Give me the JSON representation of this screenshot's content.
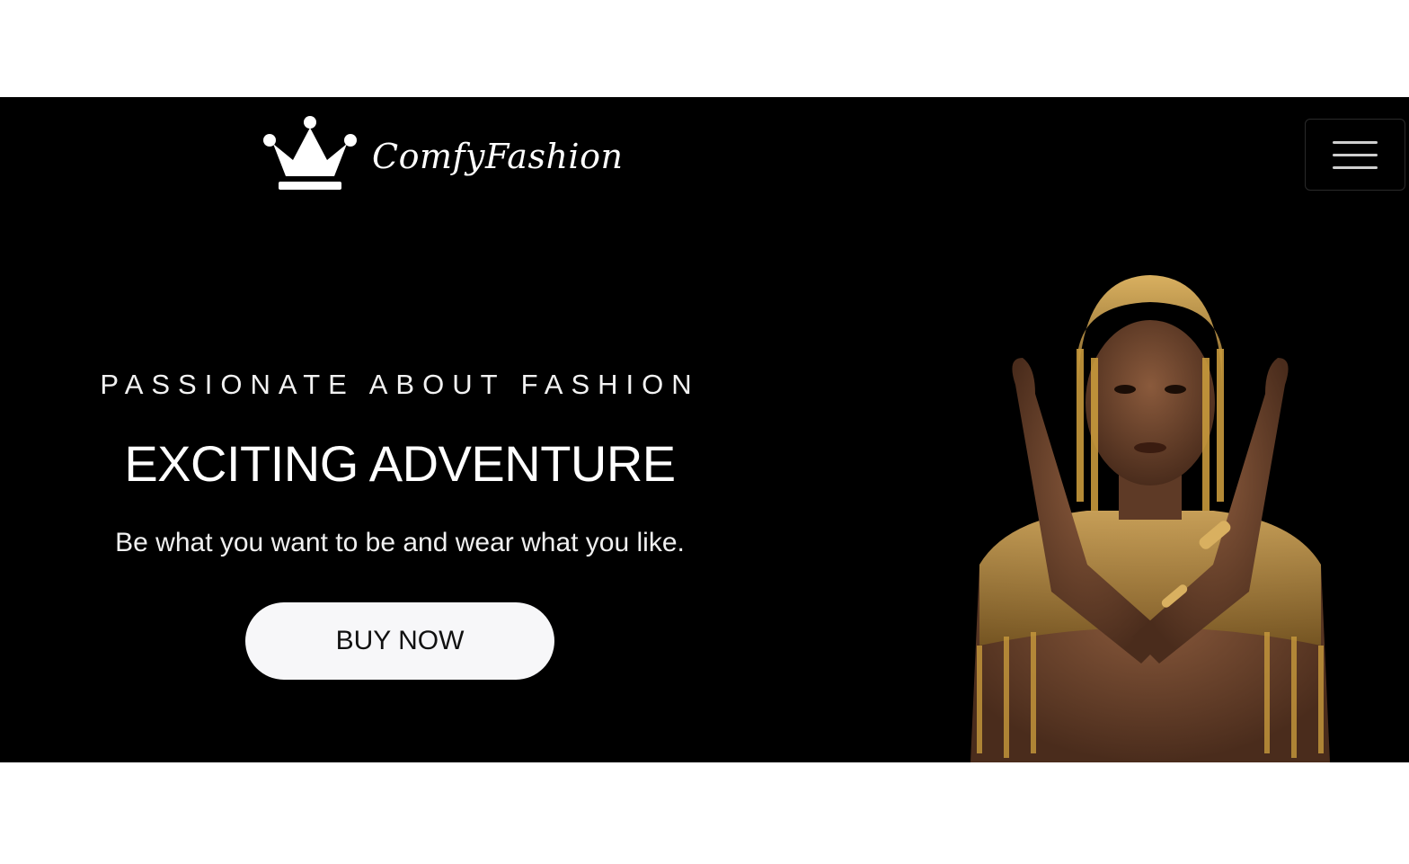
{
  "brand": {
    "name": "ComfyFashion",
    "logo_icon": "crown-icon"
  },
  "nav": {
    "menu_icon": "hamburger-menu-icon"
  },
  "hero": {
    "eyebrow": "PASSIONATE ABOUT FASHION",
    "headline": "EXCITING ADVENTURE",
    "tagline": "Be what you want to be and wear what you like.",
    "cta_label": "BUY NOW",
    "image": "model-photo-gold-headdress"
  },
  "colors": {
    "hero_background": "#000000",
    "text": "#ffffff",
    "button_background": "#f7f7f9",
    "button_text": "#111111",
    "gold_accent": "#c89a3c"
  }
}
